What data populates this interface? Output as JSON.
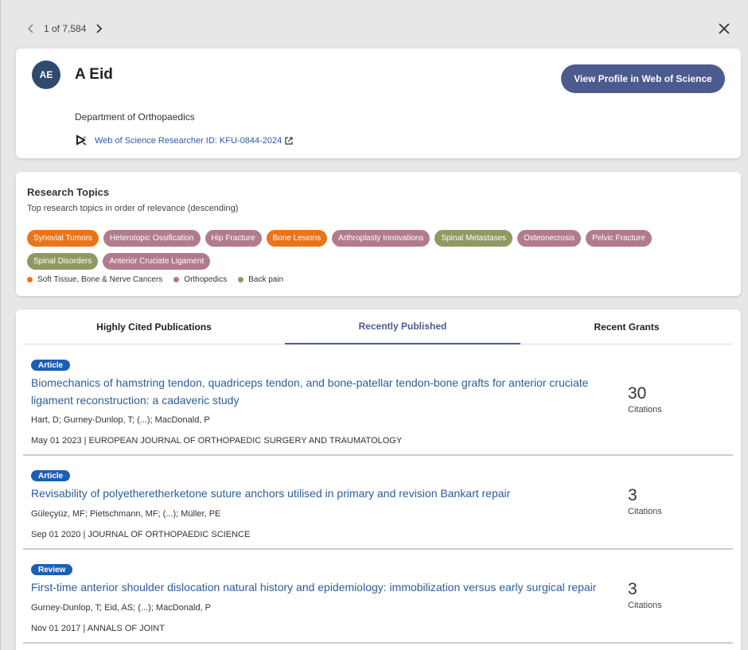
{
  "pager": {
    "count": "1 of 7,584"
  },
  "profile": {
    "initials": "AE",
    "name": "A Eid",
    "department": "Department of Orthopaedics",
    "researcher_id": "Web of Science Researcher ID: KFU-0844-2024",
    "view_profile_label": "View Profile in Web of Science"
  },
  "topics": {
    "title": "Research Topics",
    "subtitle": "Top research topics in order of relevance (descending)",
    "chips": [
      {
        "label": "Synovial Tumors",
        "color": "#e8751a"
      },
      {
        "label": "Heterotopic Ossification",
        "color": "#b27b8c"
      },
      {
        "label": "Hip Fracture",
        "color": "#b27b8c"
      },
      {
        "label": "Bone Lesions",
        "color": "#e8751a"
      },
      {
        "label": "Arthroplasty Innovations",
        "color": "#b27b8c"
      },
      {
        "label": "Spinal Metastases",
        "color": "#8f9a63"
      },
      {
        "label": "Osteonecrosis",
        "color": "#b27b8c"
      },
      {
        "label": "Pelvic Fracture",
        "color": "#b27b8c"
      },
      {
        "label": "Spinal Disorders",
        "color": "#8f9a63"
      },
      {
        "label": "Anterior Cruciate Ligament",
        "color": "#b27b8c"
      }
    ],
    "legend": [
      {
        "label": "Soft Tissue, Bone & Nerve Cancers",
        "color": "#e8751a"
      },
      {
        "label": "Orthopedics",
        "color": "#b27b8c"
      },
      {
        "label": "Back pain",
        "color": "#8f9a63"
      }
    ]
  },
  "tabs": {
    "highly_cited": "Highly Cited Publications",
    "recently_published": "Recently Published",
    "recent_grants": "Recent Grants"
  },
  "publications": [
    {
      "type": "Article",
      "title": "Biomechanics of hamstring tendon, quadriceps tendon, and bone-patellar tendon-bone grafts for anterior cruciate ligament reconstruction: a cadaveric study",
      "authors": "Hart, D; Gurney-Dunlop, T; (...); MacDonald, P",
      "meta": "May 01 2023 | EUROPEAN JOURNAL OF ORTHOPAEDIC SURGERY AND TRAUMATOLOGY",
      "citations": "30",
      "citations_label": "Citations"
    },
    {
      "type": "Article",
      "title": "Revisability of polyetheretherketone suture anchors utilised in primary and revision Bankart repair",
      "authors": "Güleçyüz, MF; Pietschmann, MF; (...); Müller, PE",
      "meta": "Sep 01 2020 | JOURNAL OF ORTHOPAEDIC SCIENCE",
      "citations": "3",
      "citations_label": "Citations"
    },
    {
      "type": "Review",
      "title": "First-time anterior shoulder dislocation natural history and epidemiology: immobilization versus early surgical repair",
      "authors": "Gurney-Dunlop, T; Eid, AS; (...); MacDonald, P",
      "meta": "Nov 01 2017 | ANNALS OF JOINT",
      "citations": "3",
      "citations_label": "Citations"
    }
  ]
}
